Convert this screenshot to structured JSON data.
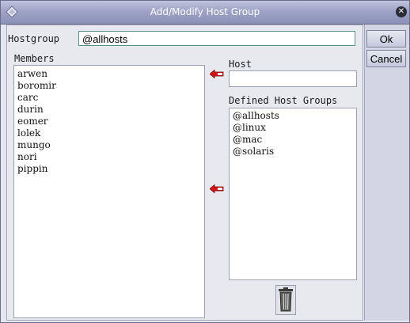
{
  "window": {
    "title": "Add/Modify Host Group"
  },
  "form": {
    "hostgroup_label": "Hostgroup",
    "hostgroup_value": "@allhosts",
    "members_label": "Members",
    "members": [
      "arwen",
      "boromir",
      "carc",
      "durin",
      "eomer",
      "lolek",
      "mungo",
      "nori",
      "pippin"
    ],
    "host_label": "Host",
    "host_value": "",
    "defined_label": "Defined Host Groups",
    "defined_groups": [
      "@allhosts",
      "@linux",
      "@mac",
      "@solaris"
    ]
  },
  "buttons": {
    "ok": "Ok",
    "cancel": "Cancel"
  },
  "icons": {
    "move_to_members": "red-left-arrow-icon",
    "delete": "trash-icon",
    "close": "close-icon"
  },
  "colors": {
    "titlebar": "#9ea3c6",
    "arrow": "#d01818",
    "input_border": "#5a8f86"
  }
}
